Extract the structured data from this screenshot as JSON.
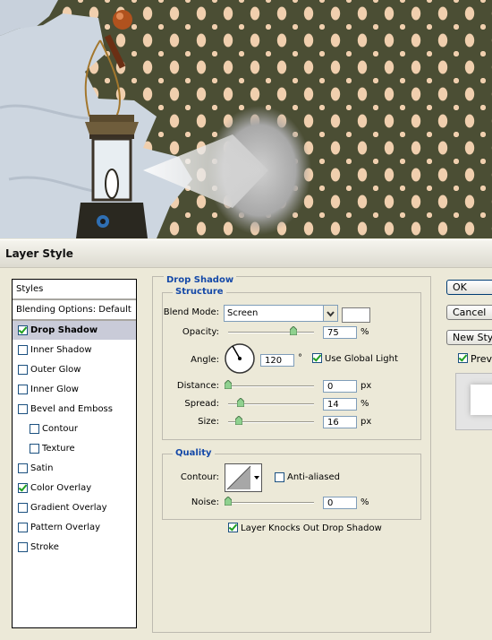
{
  "window": {
    "title": "Layer Style"
  },
  "styles_list": {
    "header": "Styles",
    "blending": "Blending Options: Default",
    "items": [
      {
        "label": "Drop Shadow",
        "checked": true,
        "selected": true,
        "sub": false
      },
      {
        "label": "Inner Shadow",
        "checked": false,
        "selected": false,
        "sub": false
      },
      {
        "label": "Outer Glow",
        "checked": false,
        "selected": false,
        "sub": false
      },
      {
        "label": "Inner Glow",
        "checked": false,
        "selected": false,
        "sub": false
      },
      {
        "label": "Bevel and Emboss",
        "checked": false,
        "selected": false,
        "sub": false
      },
      {
        "label": "Contour",
        "checked": false,
        "selected": false,
        "sub": true
      },
      {
        "label": "Texture",
        "checked": false,
        "selected": false,
        "sub": true
      },
      {
        "label": "Satin",
        "checked": false,
        "selected": false,
        "sub": false
      },
      {
        "label": "Color Overlay",
        "checked": true,
        "selected": false,
        "sub": false
      },
      {
        "label": "Gradient Overlay",
        "checked": false,
        "selected": false,
        "sub": false
      },
      {
        "label": "Pattern Overlay",
        "checked": false,
        "selected": false,
        "sub": false
      },
      {
        "label": "Stroke",
        "checked": false,
        "selected": false,
        "sub": false
      }
    ]
  },
  "drop_shadow": {
    "section_title": "Drop Shadow",
    "structure": {
      "title": "Structure",
      "blend_mode_label": "Blend Mode:",
      "blend_mode_value": "Screen",
      "shadow_color": "#ffffff",
      "opacity_label": "Opacity:",
      "opacity_value": "75",
      "opacity_unit": "%",
      "angle_label": "Angle:",
      "angle_value": "120",
      "angle_unit": "°",
      "use_global_light_label": "Use Global Light",
      "use_global_light_checked": true,
      "distance_label": "Distance:",
      "distance_value": "0",
      "distance_unit": "px",
      "spread_label": "Spread:",
      "spread_value": "14",
      "spread_unit": "%",
      "size_label": "Size:",
      "size_value": "16",
      "size_unit": "px"
    },
    "quality": {
      "title": "Quality",
      "contour_label": "Contour:",
      "anti_aliased_label": "Anti-aliased",
      "anti_aliased_checked": false,
      "noise_label": "Noise:",
      "noise_value": "0",
      "noise_unit": "%"
    },
    "knocks_out_label": "Layer Knocks Out Drop Shadow",
    "knocks_out_checked": true
  },
  "buttons": {
    "ok": "OK",
    "cancel": "Cancel",
    "new_style": "New Style...",
    "preview": "Preview",
    "preview_checked": true
  }
}
